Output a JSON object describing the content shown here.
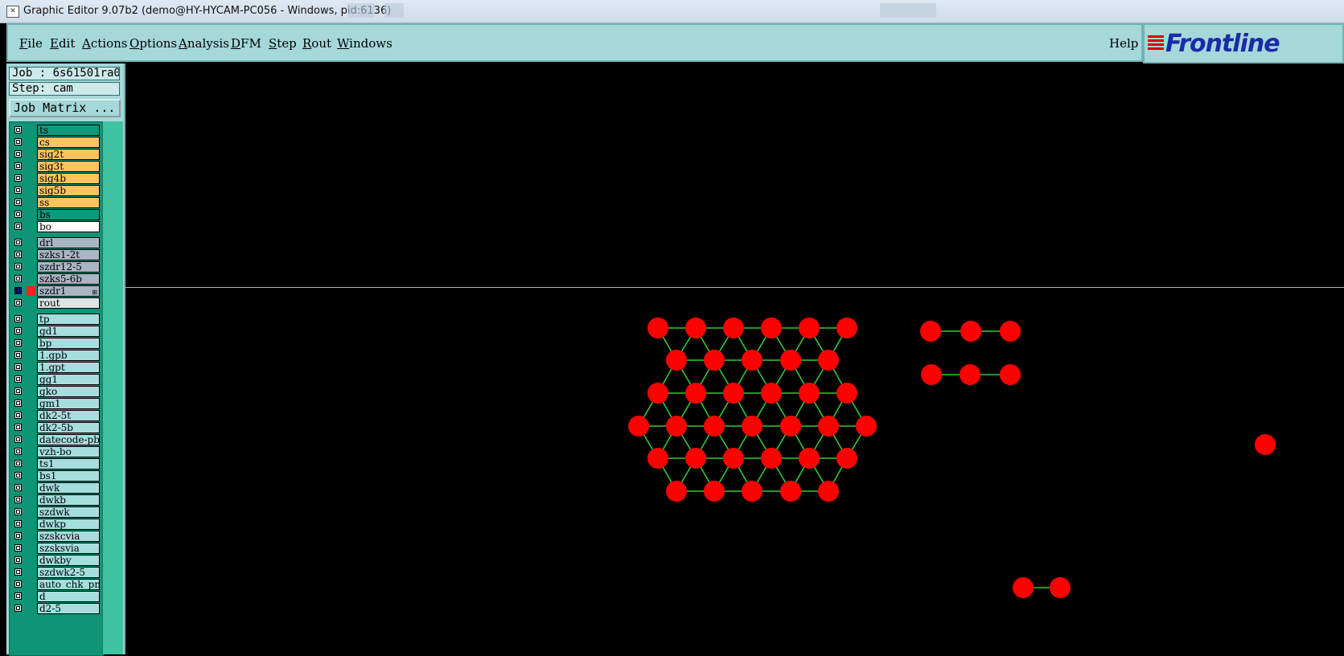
{
  "window": {
    "title": "Graphic Editor 9.07b2 (demo@HY-HYCAM-PC056 - Windows, pid:6136)"
  },
  "menu": {
    "items": [
      {
        "label": "File",
        "underline": "F",
        "rest": "ile"
      },
      {
        "label": "Edit",
        "underline": "E",
        "rest": "dit"
      },
      {
        "label": "Actions",
        "underline": "A",
        "rest": "ctions"
      },
      {
        "label": "Options",
        "underline": "O",
        "rest": "ptions"
      },
      {
        "label": "Analysis",
        "underline": "A",
        "rest": "nalysis"
      },
      {
        "label": "DFM",
        "underline": "D",
        "rest": "FM"
      },
      {
        "label": "Step",
        "underline": "S",
        "rest": "tep"
      },
      {
        "label": "Rout",
        "underline": "R",
        "rest": "out"
      },
      {
        "label": "Windows",
        "underline": "W",
        "rest": "indows"
      }
    ],
    "help": "Help"
  },
  "logo": {
    "text": "Frontline"
  },
  "job": {
    "job_label": "Job : 6s61501ra0",
    "step_label": "Step: cam",
    "matrix_button": "Job Matrix ..."
  },
  "colors": {
    "board_signal": "#0f9a7b",
    "signal": "#ffc45c",
    "white": "#ffffff",
    "drill": "#a8b6c4",
    "rout": "#dde4e4",
    "misc": "#a6dede",
    "pad": "#ff0000",
    "line": "#32c832"
  },
  "layers": [
    {
      "name": "ts",
      "color": "#0f9a7b"
    },
    {
      "name": "cs",
      "color": "#ffc45c"
    },
    {
      "name": "sig2t",
      "color": "#ffc45c"
    },
    {
      "name": "sig3t",
      "color": "#ffc45c"
    },
    {
      "name": "sig4b",
      "color": "#ffc45c"
    },
    {
      "name": "sig5b",
      "color": "#ffc45c"
    },
    {
      "name": "ss",
      "color": "#ffc45c"
    },
    {
      "name": "bs",
      "color": "#0f9a7b"
    },
    {
      "name": "bo",
      "color": "#ffffff"
    },
    {
      "name": "drl",
      "color": "#a8b6c4"
    },
    {
      "name": "szks1-2t",
      "color": "#a8b6c4"
    },
    {
      "name": "szdr12-5",
      "color": "#a8b6c4"
    },
    {
      "name": "szks5-6b",
      "color": "#a8b6c4"
    },
    {
      "name": "szdr1",
      "color": "#a8b6c4",
      "active": true
    },
    {
      "name": "rout",
      "color": "#dde4e4"
    },
    {
      "name": "tp",
      "color": "#a6dede"
    },
    {
      "name": "gd1",
      "color": "#a6dede"
    },
    {
      "name": "bp",
      "color": "#a6dede"
    },
    {
      "name": "1.gpb",
      "color": "#a6dede"
    },
    {
      "name": "1.gpt",
      "color": "#a6dede"
    },
    {
      "name": "gg1",
      "color": "#a6dede"
    },
    {
      "name": "gko",
      "color": "#a6dede"
    },
    {
      "name": "gm1",
      "color": "#a6dede"
    },
    {
      "name": "dk2-5t",
      "color": "#a6dede"
    },
    {
      "name": "dk2-5b",
      "color": "#a6dede"
    },
    {
      "name": "datecode-pbc",
      "color": "#a6dede"
    },
    {
      "name": "vzh-bo",
      "color": "#a6dede"
    },
    {
      "name": "ts1",
      "color": "#a6dede"
    },
    {
      "name": "bs1",
      "color": "#a6dede"
    },
    {
      "name": "dwk",
      "color": "#a6dede"
    },
    {
      "name": "dwkb",
      "color": "#a6dede"
    },
    {
      "name": "szdwk",
      "color": "#a6dede"
    },
    {
      "name": "dwkp",
      "color": "#a6dede"
    },
    {
      "name": "szskcvia",
      "color": "#a6dede"
    },
    {
      "name": "szsksvia",
      "color": "#a6dede"
    },
    {
      "name": "dwkby",
      "color": "#a6dede"
    },
    {
      "name": "szdwk2-5",
      "color": "#a6dede"
    },
    {
      "name": "auto_chk_pnl",
      "color": "#a6dede"
    },
    {
      "name": "d",
      "color": "#a6dede"
    },
    {
      "name": "d2-5",
      "color": "#a6dede"
    }
  ]
}
